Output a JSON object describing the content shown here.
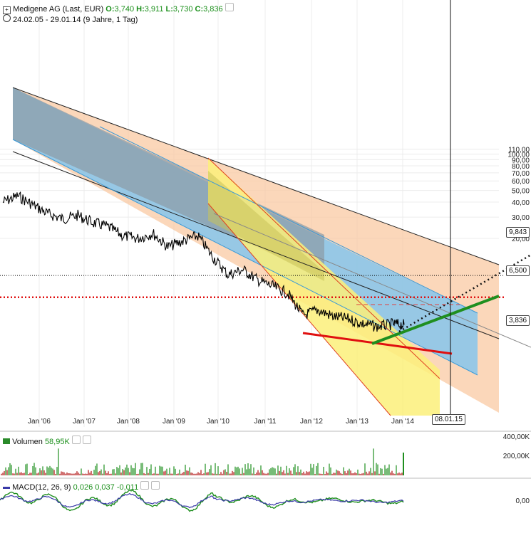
{
  "header": {
    "title": "Medigene AG (Last, EUR)",
    "open_label": "O:",
    "open": "3,740",
    "high_label": "H:",
    "high": "3,911",
    "low_label": "L:",
    "low": "3,730",
    "close_label": "C:",
    "close": "3,836",
    "range": "24.02.05 - 29.01.14 (9 Jahre, 1 Tag)"
  },
  "price_axis": {
    "ticks": [
      "110,00",
      "100,00",
      "90,00",
      "80,00",
      "70,00",
      "60,00",
      "50,00",
      "40,00",
      "30,00",
      "20,00"
    ],
    "tick_values": [
      110,
      100,
      90,
      80,
      70,
      60,
      50,
      40,
      30,
      20
    ],
    "log_scale": true
  },
  "time_axis": {
    "ticks": [
      "Jan '06",
      "Jan '07",
      "Jan '08",
      "Jan '09",
      "Jan '10",
      "Jan '11",
      "Jan '12",
      "Jan '13",
      "Jan '14"
    ]
  },
  "levels": [
    {
      "label": "9,843",
      "value": 9.843,
      "style": "dotted",
      "color": "#000000"
    },
    {
      "label": "6,500",
      "value": 6.5,
      "style": "dotted",
      "color": "#e01010"
    },
    {
      "label": "3,836",
      "value": 3.836,
      "style": "solid",
      "color": "#000000"
    }
  ],
  "cursor_date": "08.01.15",
  "volume": {
    "title": "Volumen",
    "value": "58,95K",
    "ticks": [
      "400,00K",
      "200,00K"
    ],
    "tick_values": [
      400,
      200
    ]
  },
  "macd": {
    "title": "MACD(12, 26, 9)",
    "v1": "0,026",
    "v2": "0,037",
    "v3": "-0,011",
    "ticks": [
      "0,00"
    ]
  },
  "colors": {
    "channel_orange": "#f9c9a3",
    "channel_blue": "#7ec4f0",
    "channel_yellow": "#fbf07a",
    "channel_gray": "#9aa7b0",
    "support_red": "#e01010",
    "support_green": "#1f8f1f",
    "volume_bar": "#b01010",
    "macd_line": "#1f8f1f",
    "signal_line": "#3a3aa8"
  },
  "chart_data": {
    "type": "line",
    "title": "Medigene AG (Last, EUR)",
    "xlabel": "",
    "ylabel": "",
    "x": [
      "2005-02",
      "2005-06",
      "2005-10",
      "2006-02",
      "2006-06",
      "2006-10",
      "2007-02",
      "2007-06",
      "2007-10",
      "2008-02",
      "2008-06",
      "2008-10",
      "2009-02",
      "2009-06",
      "2009-10",
      "2010-02",
      "2010-06",
      "2010-10",
      "2011-02",
      "2011-06",
      "2011-10",
      "2012-02",
      "2012-06",
      "2012-10",
      "2013-02",
      "2013-06",
      "2013-10",
      "2014-01"
    ],
    "series": [
      {
        "values": [
          40,
          45,
          38,
          32,
          29,
          31,
          27,
          25,
          21,
          20,
          22,
          17,
          19,
          21,
          14,
          10,
          11,
          9,
          8,
          7,
          4.6,
          5.1,
          4.5,
          4.3,
          3.9,
          3.7,
          3.9,
          3.84
        ]
      }
    ],
    "ylim": [
      3,
      110
    ],
    "log_scale": true,
    "grid": true
  }
}
